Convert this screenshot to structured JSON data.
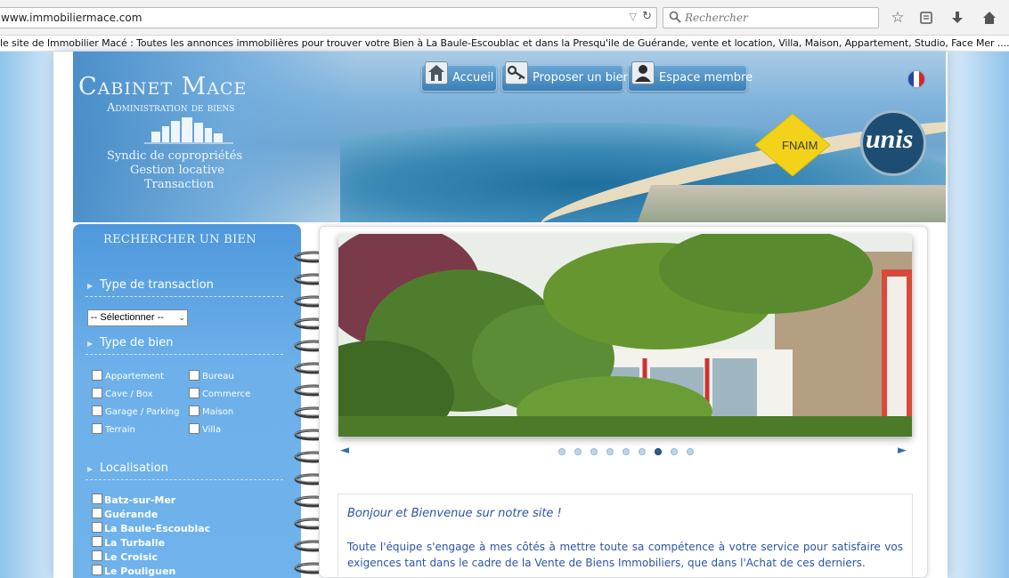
{
  "browser": {
    "url": "www.immobiliermace.com",
    "search_placeholder": "Rechercher",
    "page_title": "le site de Immobilier Macé : Toutes les annonces immobilières pour trouver votre Bien à La Baule-Escoublac et dans la Presqu'ile de Guérande, vente et location, Villa, Maison, Appartement, Studio, Face Mer ....."
  },
  "header": {
    "logo_title": "Cabinet Mace",
    "logo_subtitle": "Administration de biens",
    "logo_lines": [
      "Syndic de copropriétés",
      "Gestion locative",
      "Transaction"
    ],
    "nav": [
      {
        "label": "Accueil",
        "icon": "home-icon"
      },
      {
        "label": "Proposer un bien",
        "icon": "key-icon"
      },
      {
        "label": "Espace membre",
        "icon": "user-icon"
      }
    ],
    "fnaim_label": "FNAIM",
    "unis_label": "unis",
    "flag": "france-flag-icon"
  },
  "sidebar": {
    "title": "Rechercher un bien",
    "transaction": {
      "title": "Type de transaction",
      "selected": "-- Sélectionner --"
    },
    "type_bien": {
      "title": "Type de bien",
      "options_col1": [
        "Appartement",
        "Cave / Box",
        "Garage / Parking",
        "Terrain"
      ],
      "options_col2": [
        "Bureau",
        "Commerce",
        "Maison",
        "Villa"
      ]
    },
    "localisation": {
      "title": "Localisation",
      "options": [
        "Batz-sur-Mer",
        "Guérande",
        "La Baule-Escoublac",
        "La Turballe",
        "Le Croisic",
        "Le Pouliguen"
      ]
    }
  },
  "main": {
    "slideshow": {
      "slide_count": 9,
      "active_index": 6
    },
    "welcome_title": "Bonjour et Bienvenue sur notre site !",
    "welcome_text": "Toute l'équipe s'engage à mes côtés à mettre toute  sa compétence à votre service pour satisfaire vos exigences tant dans le cadre de la Vente de Biens Immobiliers, que dans l'Achat de ces derniers."
  },
  "colors": {
    "sidebar_blue": "#6db0ea",
    "nav_blue": "#3a7fb8",
    "text_blue": "#2a55a8",
    "fnaim_yellow": "#f3d31a"
  }
}
